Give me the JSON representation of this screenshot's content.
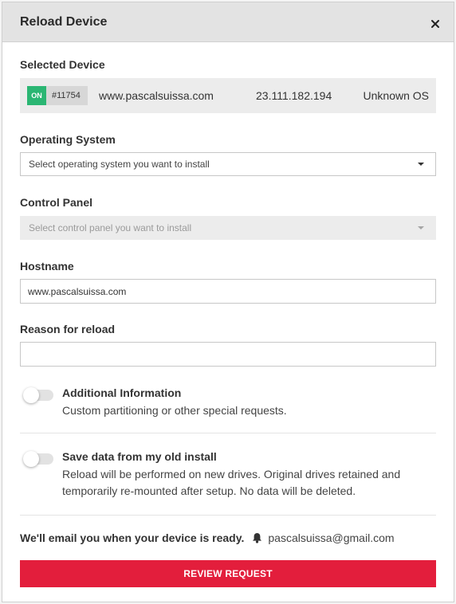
{
  "header": {
    "title": "Reload Device",
    "close_icon": "close-icon"
  },
  "selected_device": {
    "label": "Selected Device",
    "status": "ON",
    "status_color": "#2bb673",
    "id": "#11754",
    "hostname": "www.pascalsuissa.com",
    "ip": "23.111.182.194",
    "os": "Unknown OS"
  },
  "operating_system": {
    "label": "Operating System",
    "placeholder": "Select operating system you want to install"
  },
  "control_panel": {
    "label": "Control Panel",
    "placeholder": "Select control panel you want to install"
  },
  "hostname": {
    "label": "Hostname",
    "value": "www.pascalsuissa.com"
  },
  "reason": {
    "label": "Reason for reload",
    "value": ""
  },
  "options": [
    {
      "title": "Additional Information",
      "description": "Custom partitioning or other special requests.",
      "enabled": false
    },
    {
      "title": "Save data from my old install",
      "description": "Reload will be performed on new drives. Original drives retained and temporarily re-mounted after setup. No data will be deleted.",
      "enabled": false
    }
  ],
  "footer": {
    "email_note": "We'll email you when your device is ready.",
    "bell_icon": "bell-icon",
    "email": "pascalsuissa@gmail.com",
    "review_button": "REVIEW REQUEST",
    "accent_color": "#e31e3c"
  }
}
